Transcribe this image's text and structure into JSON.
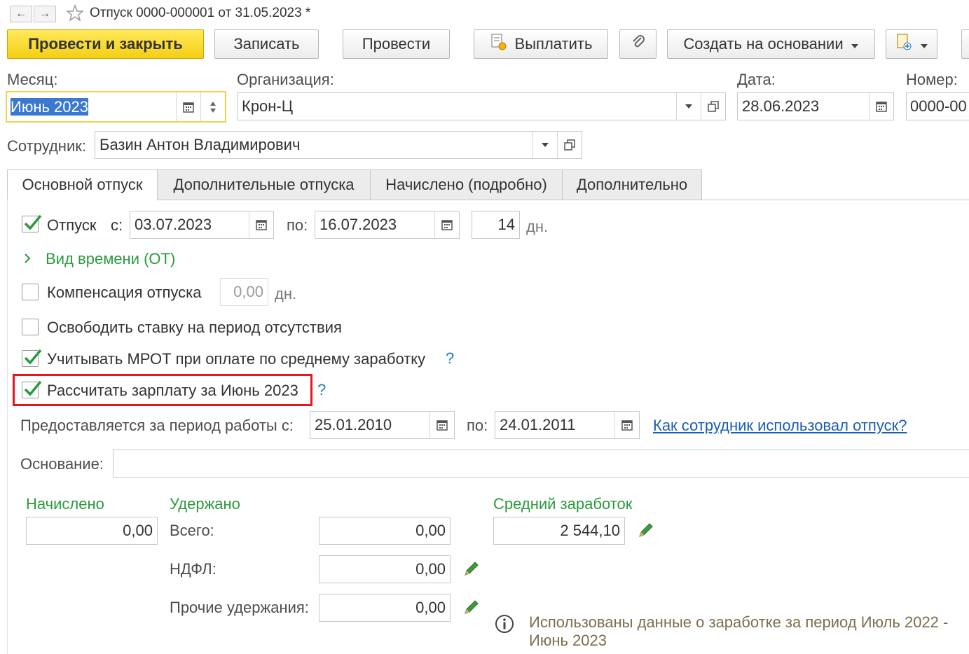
{
  "window": {
    "title": "Отпуск 0000-000001 от 31.05.2023 *"
  },
  "toolbar": {
    "post_close": "Провести и закрыть",
    "save": "Записать",
    "post": "Провести",
    "pay": "Выплатить",
    "create_based": "Создать на основании"
  },
  "header": {
    "month_label": "Месяц:",
    "month_value": "Июнь 2023",
    "org_label": "Организация:",
    "org_value": "Крон-Ц",
    "date_label": "Дата:",
    "date_value": "28.06.2023",
    "number_label": "Номер:",
    "number_value": "0000-00",
    "employee_label": "Сотрудник:",
    "employee_value": "Базин Антон Владимирович"
  },
  "tabs": [
    "Основной отпуск",
    "Дополнительные отпуска",
    "Начислено (подробно)",
    "Дополнительно"
  ],
  "main": {
    "vacation_label": "Отпуск",
    "from_label": "с:",
    "from_value": "03.07.2023",
    "to_label": "по:",
    "to_value": "16.07.2023",
    "days_value": "14",
    "days_unit": "дн.",
    "time_type_link": "Вид времени (ОТ)",
    "compensation_label": "Компенсация отпуска",
    "compensation_value": "0,00",
    "compensation_unit": "дн.",
    "release_rate_label": "Освободить ставку на период отсутствия",
    "mrot_label": "Учитывать МРОТ при оплате по среднему заработку",
    "mrot_help": "?",
    "calc_salary_label": "Рассчитать зарплату за Июнь 2023",
    "calc_salary_help": "?",
    "period_label": "Предоставляется за период работы с:",
    "period_from": "25.01.2010",
    "period_to_label": "по:",
    "period_to": "24.01.2011",
    "usage_link": "Как сотрудник использовал отпуск?",
    "basis_label": "Основание:",
    "basis_value": ""
  },
  "totals": {
    "accrued_title": "Начислено",
    "accrued_value": "0,00",
    "withheld_title": "Удержано",
    "total_label": "Всего:",
    "total_value": "0,00",
    "ndfl_label": "НДФЛ:",
    "ndfl_value": "0,00",
    "other_label": "Прочие удержания:",
    "other_value": "0,00",
    "avg_title": "Средний заработок",
    "avg_value": "2 544,10",
    "info_text": "Использованы данные о заработке за период Июль 2022 - Июнь 2023"
  },
  "colors": {
    "accent_yellow": "#f4cf14",
    "green": "#2b9a3e",
    "link": "#1a5fb4",
    "highlight_red": "#e8161e"
  },
  "icons": {
    "calendar": "calendar-icon",
    "dropdown": "chevron-down-icon",
    "open": "open-form-icon",
    "pencil": "pencil-icon",
    "info": "info-icon",
    "star": "star-icon"
  }
}
